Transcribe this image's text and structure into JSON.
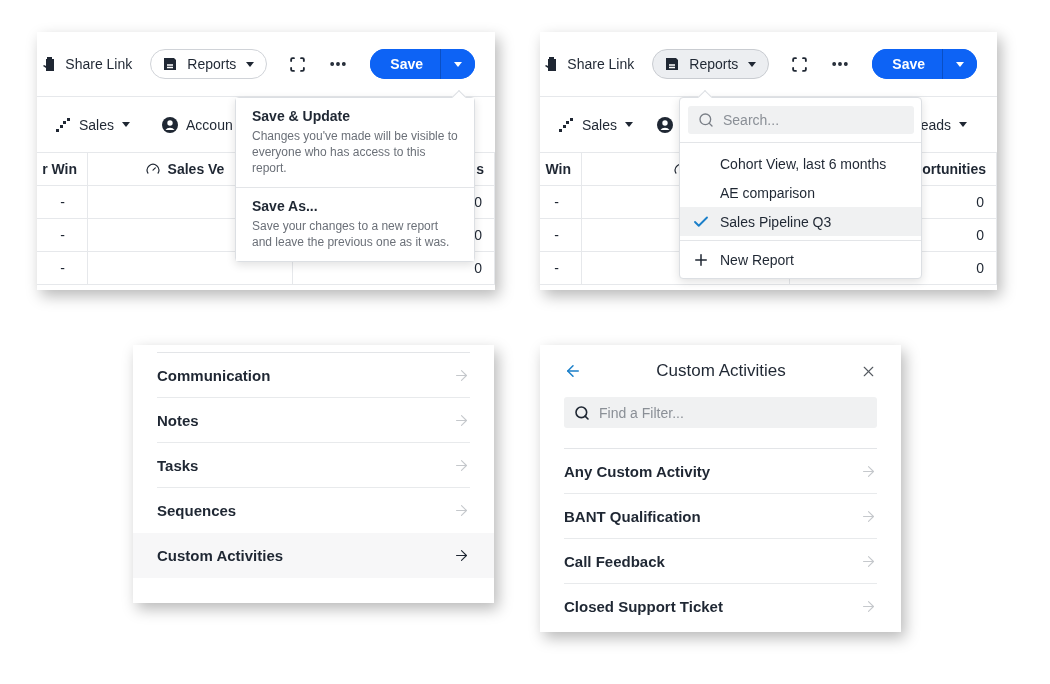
{
  "save_menu_view": {
    "toolbar": {
      "share_link": "Share Link",
      "reports": {
        "label": "Reports",
        "expanded": false
      },
      "save": "Save"
    },
    "filters": [
      "Sales",
      "Accoun"
    ],
    "table": {
      "columns": [
        {
          "label": "r Win",
          "kind": "plain"
        },
        {
          "label": "Sales Ve",
          "kind": "gauge"
        },
        {
          "label": "s",
          "kind": "plain"
        }
      ],
      "rows": [
        {
          "cells": [
            "-",
            "0"
          ]
        },
        {
          "cells": [
            "-",
            "0"
          ]
        },
        {
          "cells": [
            "-",
            "0"
          ]
        }
      ]
    },
    "menu": [
      {
        "title": "Save & Update",
        "description": "Changes you've made will be visible to everyone who has access to this report."
      },
      {
        "title": "Save As...",
        "description": "Save your changes to a new report and leave the previous one as it was."
      }
    ]
  },
  "reports_menu_view": {
    "toolbar": {
      "share_link": "Share Link",
      "reports": {
        "label": "Reports",
        "expanded": true
      },
      "save": "Save"
    },
    "filters": [
      "Sales",
      "eads"
    ],
    "table": {
      "columns": [
        {
          "label": "Win",
          "kind": "plain"
        },
        {
          "kind": "gauge"
        },
        {
          "label": "ortunities",
          "kind": "plain"
        }
      ],
      "rows": [
        {
          "cells": [
            "-",
            "0"
          ]
        },
        {
          "cells": [
            "-",
            "0"
          ]
        },
        {
          "cells": [
            "-",
            "0"
          ]
        }
      ]
    },
    "menu": {
      "search": {
        "placeholder": "Search..."
      },
      "items": [
        {
          "label": "Cohort View, last 6 months",
          "selected": false
        },
        {
          "label": "AE comparison",
          "selected": false
        },
        {
          "label": "Sales Pipeline Q3",
          "selected": true
        }
      ],
      "new_report": "New Report"
    }
  },
  "filter_categories": [
    {
      "label": "Communication",
      "selected": false
    },
    {
      "label": "Notes",
      "selected": false
    },
    {
      "label": "Tasks",
      "selected": false
    },
    {
      "label": "Sequences",
      "selected": false
    },
    {
      "label": "Custom Activities",
      "selected": true
    }
  ],
  "custom_activities_filter": {
    "title": "Custom Activities",
    "search": {
      "placeholder": "Find a Filter..."
    },
    "items": [
      "Any Custom Activity",
      "BANT Qualification",
      "Call Feedback",
      "Closed Support Ticket"
    ]
  }
}
